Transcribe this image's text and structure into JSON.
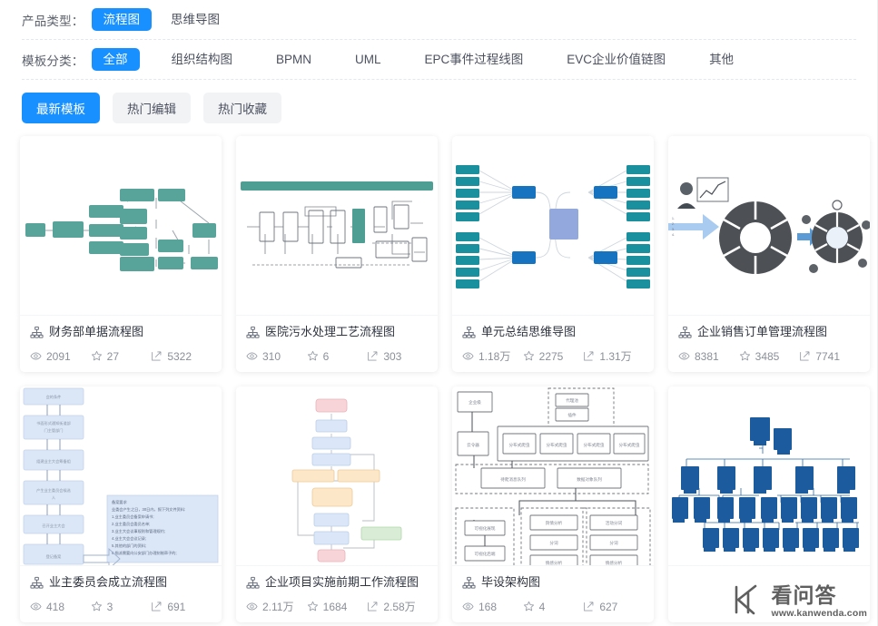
{
  "filters": {
    "product_type": {
      "label": "产品类型：",
      "options": [
        {
          "label": "流程图",
          "active": true
        },
        {
          "label": "思维导图",
          "active": false
        }
      ]
    },
    "template_category": {
      "label": "模板分类：",
      "options": [
        {
          "label": "全部",
          "active": true
        },
        {
          "label": "组织结构图",
          "active": false
        },
        {
          "label": "BPMN",
          "active": false
        },
        {
          "label": "UML",
          "active": false
        },
        {
          "label": "EPC事件过程线图",
          "active": false
        },
        {
          "label": "EVC企业价值链图",
          "active": false
        },
        {
          "label": "其他",
          "active": false
        }
      ]
    },
    "sort_tabs": [
      {
        "label": "最新模板",
        "active": true
      },
      {
        "label": "热门编辑",
        "active": false
      },
      {
        "label": "热门收藏",
        "active": false
      }
    ]
  },
  "icons": {
    "title": "sitemap-icon",
    "views": "eye-icon",
    "favorites": "star-icon",
    "edits": "edit-icon"
  },
  "cards": [
    {
      "title": "财务部单据流程图",
      "views": "2091",
      "favorites": "27",
      "edits": "5322",
      "thumb": "teal-flowchart"
    },
    {
      "title": "医院污水处理工艺流程图",
      "views": "310",
      "favorites": "6",
      "edits": "303",
      "thumb": "wastewater-process"
    },
    {
      "title": "单元总结思维导图",
      "views": "1.18万",
      "favorites": "2275",
      "edits": "1.31万",
      "thumb": "mindmap-blue"
    },
    {
      "title": "企业销售订单管理流程图",
      "views": "8381",
      "favorites": "3485",
      "edits": "7741",
      "thumb": "donut-infographic"
    },
    {
      "title": "业主委员会成立流程图",
      "views": "418",
      "favorites": "3",
      "edits": "691",
      "thumb": "vertical-lightblue-flow"
    },
    {
      "title": "企业项目实施前期工作流程图",
      "views": "2.11万",
      "favorites": "1684",
      "edits": "2.58万",
      "thumb": "pastel-flowchart"
    },
    {
      "title": "毕设架构图",
      "views": "168",
      "favorites": "4",
      "edits": "627",
      "thumb": "architecture-boxes"
    },
    {
      "title": "",
      "views": "",
      "favorites": "",
      "edits": "",
      "thumb": "org-chart-navy"
    }
  ],
  "watermark": {
    "brand": "看问答",
    "url": "www.kanwenda.com"
  },
  "colors": {
    "accent": "#1890ff",
    "chip_bg": "#f2f3f5",
    "teal": "#4f9e94",
    "navy": "#14538f",
    "text": "#2f3440",
    "muted": "#8a8f99"
  }
}
